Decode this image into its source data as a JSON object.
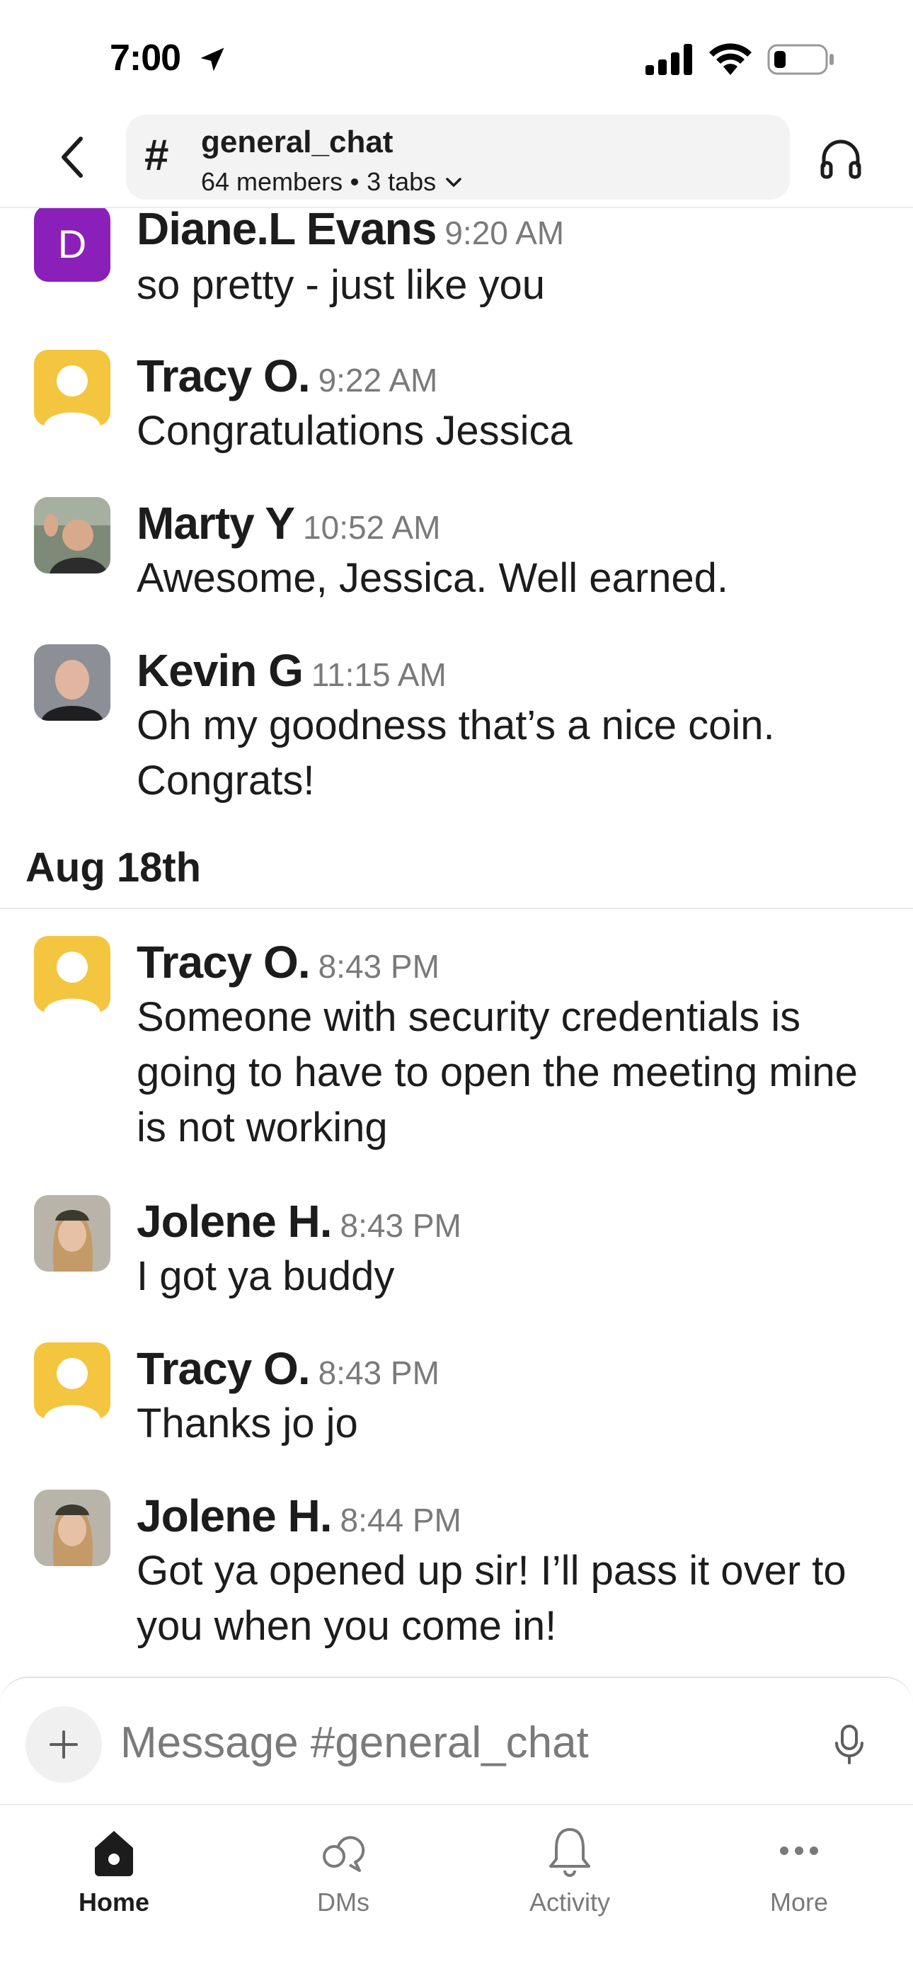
{
  "status_bar": {
    "time": "7:00"
  },
  "header": {
    "hash": "#",
    "channel_name": "general_chat",
    "members": "64 members",
    "tabs": "3 tabs"
  },
  "messages": [
    {
      "author": "Diane.L Evans",
      "time": "9:20 AM",
      "text": "so pretty - just like you",
      "avatar_letter": "D",
      "avatar": "letter"
    },
    {
      "author": "Tracy O.",
      "time": "9:22 AM",
      "text": "Congratulations Jessica",
      "avatar": "default"
    },
    {
      "author": "Marty Y",
      "time": "10:52 AM",
      "text": "Awesome, Jessica. Well earned.",
      "avatar": "photo"
    },
    {
      "author": "Kevin G",
      "time": "11:15 AM",
      "text": "Oh my goodness that’s a nice coin. Congrats!",
      "avatar": "photo"
    },
    {
      "author": "Tracy O.",
      "time": "8:43 PM",
      "text": "Someone with security credentials is going to have to open the meeting mine is not working",
      "avatar": "default"
    },
    {
      "author": "Jolene H.",
      "time": "8:43 PM",
      "text": "I got ya buddy",
      "avatar": "photo"
    },
    {
      "author": "Tracy O.",
      "time": "8:43 PM",
      "text": "Thanks jo jo",
      "avatar": "default"
    },
    {
      "author": "Jolene H.",
      "time": "8:44 PM",
      "text": "Got ya opened up sir! I’ll pass it over to you when you come in!",
      "avatar": "photo"
    }
  ],
  "date_divider": "Aug 18th",
  "composer": {
    "placeholder": "Message #general_chat"
  },
  "tab_bar": {
    "home": "Home",
    "dms": "DMs",
    "activity": "Activity",
    "more": "More"
  },
  "colors": {
    "avatar_purple": "#8a20b9",
    "avatar_yellow": "#f4c53f",
    "text_primary": "#1d1c1d",
    "text_muted": "#7a7a7a"
  }
}
